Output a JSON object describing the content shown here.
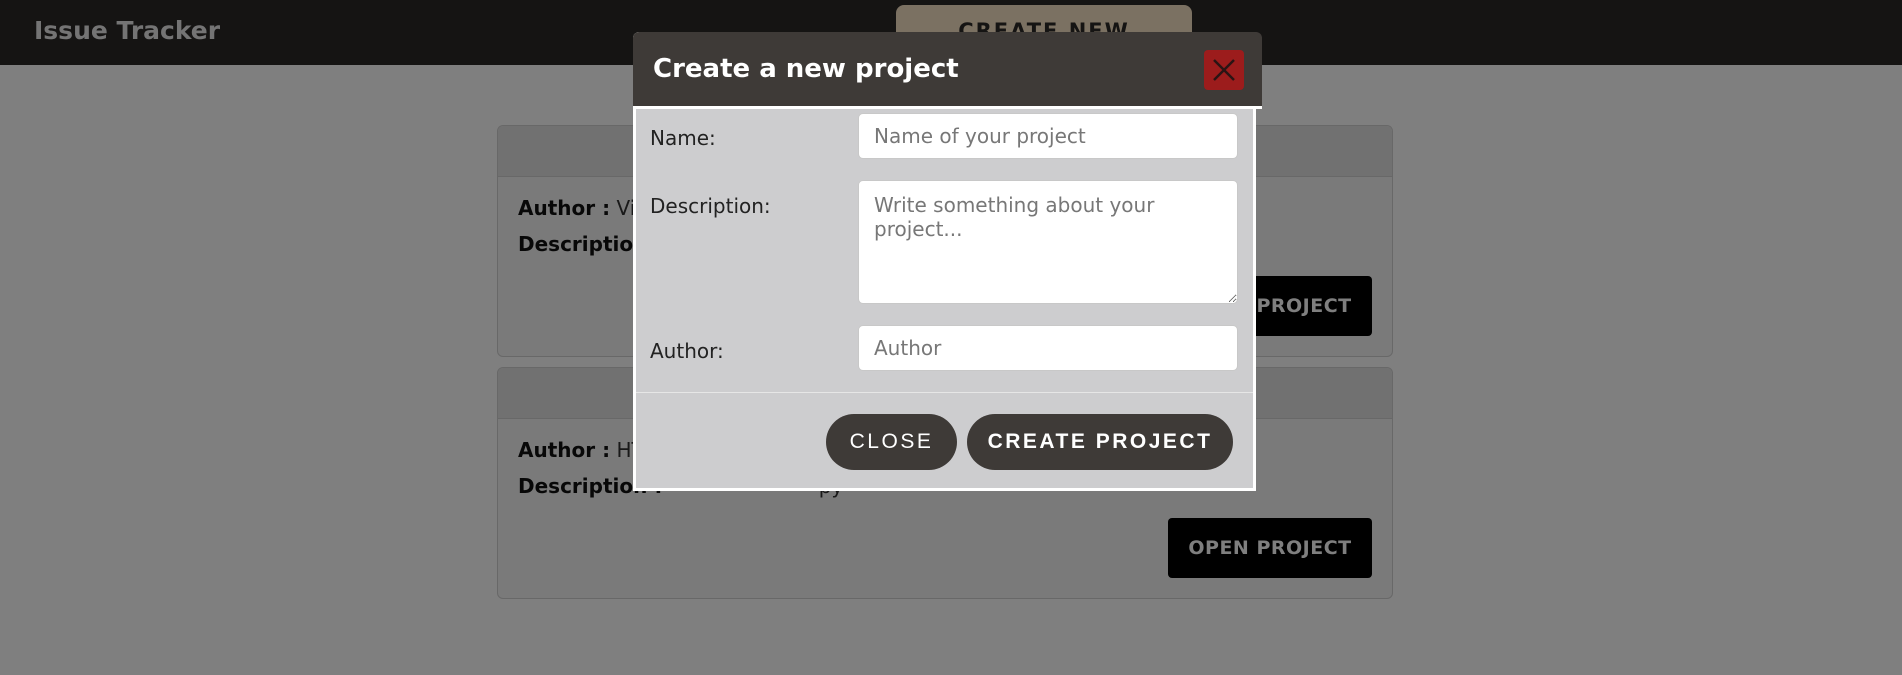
{
  "app": {
    "title": "Issue Tracker",
    "create_new_project_label": "CREATE NEW PROJECT"
  },
  "projects": [
    {
      "author_label": "Author :",
      "author_value": "Vish",
      "description_label": "Description :",
      "description_value": "",
      "open_label": "OPEN PROJECT"
    },
    {
      "author_label": "Author :",
      "author_value": "HTM",
      "description_label": "Description :",
      "description_value": "py",
      "open_label": "OPEN PROJECT"
    }
  ],
  "modal": {
    "title": "Create a new project",
    "close_icon": "close-icon",
    "fields": {
      "name": {
        "label": "Name:",
        "placeholder": "Name of your project",
        "value": ""
      },
      "description": {
        "label": "Description:",
        "placeholder": "Write something about your project...",
        "value": ""
      },
      "author": {
        "label": "Author:",
        "placeholder": "Author",
        "value": ""
      }
    },
    "buttons": {
      "close": "CLOSE",
      "create": "CREATE PROJECT"
    }
  },
  "colors": {
    "navbar": "#2a2827",
    "modal_header": "#3e3a37",
    "close_x_bg": "#9c1c1c",
    "modal_body": "#cdcdcf",
    "accent_button": "#f7e2c5"
  }
}
